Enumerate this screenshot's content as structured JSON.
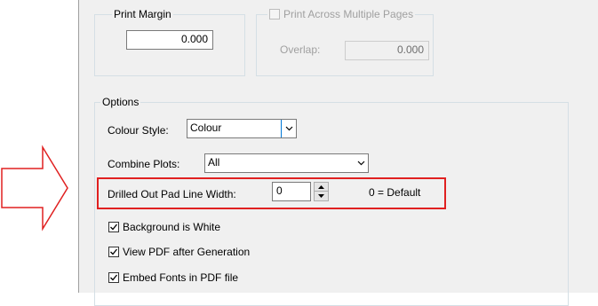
{
  "print_margin": {
    "legend": "Print Margin",
    "value": "0.000"
  },
  "print_across": {
    "label": "Print Across Multiple Pages",
    "checked": false,
    "overlap_label": "Overlap:",
    "overlap_value": "0.000"
  },
  "options": {
    "legend": "Options",
    "colour_style_label": "Colour Style:",
    "colour_style_value": "Colour",
    "combine_plots_label": "Combine Plots:",
    "combine_plots_value": "All",
    "drilled_label": "Drilled Out Pad Line Width:",
    "drilled_value": "0",
    "drilled_hint": "0 = Default",
    "background_white_label": "Background is White",
    "view_pdf_label": "View PDF after Generation",
    "embed_fonts_label": "Embed Fonts in PDF file"
  },
  "annotation": {
    "arrow_icon": "arrow-right-outline-icon",
    "highlight_color": "#e02020",
    "arrow_color": "#e02020"
  }
}
